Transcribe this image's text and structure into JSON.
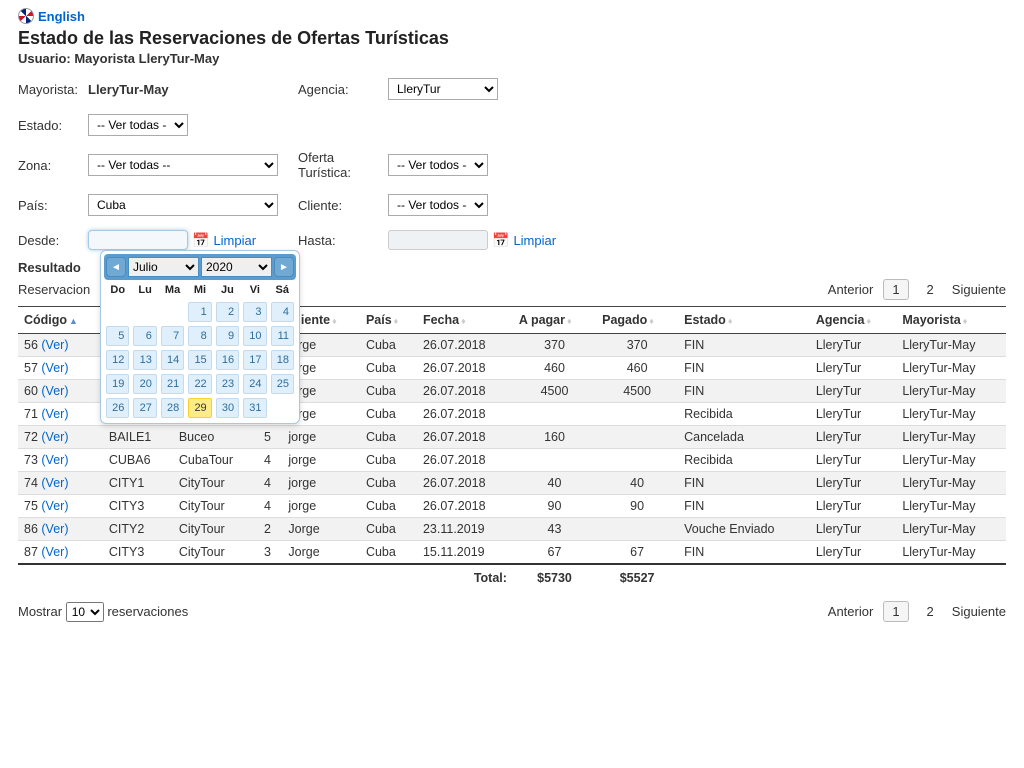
{
  "lang_link": "English",
  "title": "Estado de las Reservaciones de Ofertas Turísticas",
  "subtitle": "Usuario: Mayorista LleryTur-May",
  "filters": {
    "mayorista_label": "Mayorista:",
    "mayorista_value": "LleryTur-May",
    "agencia_label": "Agencia:",
    "agencia_value": "LleryTur",
    "estado_label": "Estado:",
    "estado_value": "-- Ver todas --",
    "zona_label": "Zona:",
    "zona_value": "-- Ver todas --",
    "oferta_label": "Oferta Turística:",
    "oferta_value": "-- Ver todos --",
    "pais_label": "País:",
    "pais_value": "Cuba",
    "cliente_label": "Cliente:",
    "cliente_value": "-- Ver todos --",
    "desde_label": "Desde:",
    "hasta_label": "Hasta:",
    "limpiar": "Limpiar"
  },
  "datepicker": {
    "month": "Julio",
    "year": "2020",
    "dow": [
      "Do",
      "Lu",
      "Ma",
      "Mi",
      "Ju",
      "Vi",
      "Sá"
    ],
    "weeks": [
      [
        "",
        "",
        "",
        "1",
        "2",
        "3",
        "4"
      ],
      [
        "5",
        "6",
        "7",
        "8",
        "9",
        "10",
        "11"
      ],
      [
        "12",
        "13",
        "14",
        "15",
        "16",
        "17",
        "18"
      ],
      [
        "19",
        "20",
        "21",
        "22",
        "23",
        "24",
        "25"
      ],
      [
        "26",
        "27",
        "28",
        "29",
        "30",
        "31",
        ""
      ]
    ],
    "today": "29"
  },
  "results": {
    "heading": "Resultado",
    "count_label": "Reservacion",
    "prev": "Anterior",
    "next": "Siguiente",
    "page1": "1",
    "page2": "2"
  },
  "columns": [
    "Código",
    "",
    "",
    "",
    "Cliente",
    "País",
    "Fecha",
    "A pagar",
    "Pagado",
    "Estado",
    "Agencia",
    "Mayorista"
  ],
  "rows": [
    {
      "cod": "56",
      "ver": "(Ver)",
      "c2": "",
      "c3": "",
      "c4": "",
      "cliente": "jorge",
      "pais": "Cuba",
      "fecha": "26.07.2018",
      "apagar": "370",
      "pagado": "370",
      "estado": "FIN",
      "agencia": "LleryTur",
      "mayorista": "LleryTur-May"
    },
    {
      "cod": "57",
      "ver": "(Ver)",
      "c2": "",
      "c3": "",
      "c4": "",
      "cliente": "jorge",
      "pais": "Cuba",
      "fecha": "26.07.2018",
      "apagar": "460",
      "pagado": "460",
      "estado": "FIN",
      "agencia": "LleryTur",
      "mayorista": "LleryTur-May"
    },
    {
      "cod": "60",
      "ver": "(Ver)",
      "c2": "",
      "c3": "",
      "c4": "",
      "cliente": "jorge",
      "pais": "Cuba",
      "fecha": "26.07.2018",
      "apagar": "4500",
      "pagado": "4500",
      "estado": "FIN",
      "agencia": "LleryTur",
      "mayorista": "LleryTur-May"
    },
    {
      "cod": "71",
      "ver": "(Ver)",
      "c2": "",
      "c3": "",
      "c4": "",
      "cliente": "jorge",
      "pais": "Cuba",
      "fecha": "26.07.2018",
      "apagar": "",
      "pagado": "",
      "estado": "Recibida",
      "agencia": "LleryTur",
      "mayorista": "LleryTur-May"
    },
    {
      "cod": "72",
      "ver": "(Ver)",
      "c2": "BAILE1",
      "c3": "Buceo",
      "c4": "5",
      "cliente": "jorge",
      "pais": "Cuba",
      "fecha": "26.07.2018",
      "apagar": "160",
      "pagado": "",
      "estado": "Cancelada",
      "agencia": "LleryTur",
      "mayorista": "LleryTur-May"
    },
    {
      "cod": "73",
      "ver": "(Ver)",
      "c2": "CUBA6",
      "c3": "CubaTour",
      "c4": "4",
      "cliente": "jorge",
      "pais": "Cuba",
      "fecha": "26.07.2018",
      "apagar": "",
      "pagado": "",
      "estado": "Recibida",
      "agencia": "LleryTur",
      "mayorista": "LleryTur-May"
    },
    {
      "cod": "74",
      "ver": "(Ver)",
      "c2": "CITY1",
      "c3": "CityTour",
      "c4": "4",
      "cliente": "jorge",
      "pais": "Cuba",
      "fecha": "26.07.2018",
      "apagar": "40",
      "pagado": "40",
      "estado": "FIN",
      "agencia": "LleryTur",
      "mayorista": "LleryTur-May"
    },
    {
      "cod": "75",
      "ver": "(Ver)",
      "c2": "CITY3",
      "c3": "CityTour",
      "c4": "4",
      "cliente": "jorge",
      "pais": "Cuba",
      "fecha": "26.07.2018",
      "apagar": "90",
      "pagado": "90",
      "estado": "FIN",
      "agencia": "LleryTur",
      "mayorista": "LleryTur-May"
    },
    {
      "cod": "86",
      "ver": "(Ver)",
      "c2": "CITY2",
      "c3": "CityTour",
      "c4": "2",
      "cliente": "Jorge",
      "pais": "Cuba",
      "fecha": "23.11.2019",
      "apagar": "43",
      "pagado": "",
      "estado": "Vouche Enviado",
      "agencia": "LleryTur",
      "mayorista": "LleryTur-May"
    },
    {
      "cod": "87",
      "ver": "(Ver)",
      "c2": "CITY3",
      "c3": "CityTour",
      "c4": "3",
      "cliente": "Jorge",
      "pais": "Cuba",
      "fecha": "15.11.2019",
      "apagar": "67",
      "pagado": "67",
      "estado": "FIN",
      "agencia": "LleryTur",
      "mayorista": "LleryTur-May"
    }
  ],
  "totals": {
    "label": "Total:",
    "apagar": "$5730",
    "pagado": "$5527"
  },
  "footer": {
    "mostrar": "Mostrar",
    "reservaciones": "reservaciones",
    "page_size": "10"
  }
}
